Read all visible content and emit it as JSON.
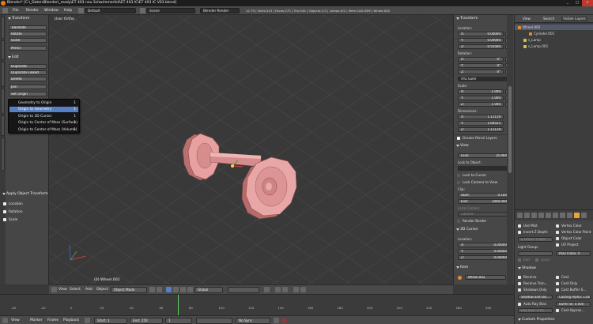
{
  "window": {
    "title": "Blender* [C:\\_Daten\\Blender\\_ready\\ET 403 neu Schwimmerfeil\\ET 403 IC\\ET 403 IC V03.blend]",
    "controls": [
      "_",
      "□",
      "×"
    ]
  },
  "info_header": {
    "menus": [
      "File",
      "Render",
      "Window",
      "Help"
    ],
    "screen_layout": "Default",
    "scene": "Scene",
    "engine": "Blender Render",
    "stats": "v2.79 | Verts:523 | Faces:275 | Tris:544 | Objects:1/3 | Lamps:0/2 | Mem:100.83M | Wheel.002"
  },
  "left_tools": {
    "tabs": [
      "Tools",
      "Create",
      "Relations",
      "Animation",
      "Physics",
      "Grease Pencil"
    ],
    "transform_header": "Transform",
    "transform_buttons": [
      "Translate",
      "Rotate",
      "Scale"
    ],
    "mirror": "Mirror",
    "edit_header": "Edit",
    "edit_buttons": [
      "Duplicate",
      "Duplicate Linked",
      "Delete",
      "Join"
    ],
    "set_origin": "Set Origin",
    "operator_header": "Apply Object Transform",
    "operator_checks": [
      {
        "label": "Location",
        "checked": true
      },
      {
        "label": "Rotation",
        "checked": true
      },
      {
        "label": "Scale",
        "checked": true
      }
    ]
  },
  "popup_menu": {
    "items": [
      {
        "label": "Geometry to Origin",
        "shortcut": "1",
        "selected": false
      },
      {
        "label": "Origin to Geometry",
        "shortcut": "1",
        "selected": true
      },
      {
        "label": "Origin to 3D Cursor",
        "shortcut": "1",
        "selected": false
      },
      {
        "label": "Origin to Center of Mass (Surface)",
        "shortcut": "1",
        "selected": false
      },
      {
        "label": "Origin to Center of Mass (Volume)",
        "shortcut": "1",
        "selected": false
      }
    ]
  },
  "viewport": {
    "view_label": "User Ortho",
    "object_label": "(0) Wheel.002",
    "model_color": "#e79d9d",
    "grid_color": "#4a4a4a",
    "axis_x_color": "#c83c3c",
    "axis_y_color": "#3fa03f",
    "axis_z_color": "#3f5fd0"
  },
  "right_panel": {
    "transform_header": "Transform",
    "location_label": "Location:",
    "location": [
      {
        "k": "X:",
        "v": "0.00000"
      },
      {
        "k": "Y:",
        "v": "0.00000"
      },
      {
        "k": "Z:",
        "v": "0.55560"
      }
    ],
    "rotation_label": "Rotation:",
    "rotation": [
      {
        "k": "X:",
        "v": "0°"
      },
      {
        "k": "Y:",
        "v": "0°"
      },
      {
        "k": "Z:",
        "v": "0°"
      }
    ],
    "rotation_mode": "XYZ Euler",
    "scale_label": "Scale:",
    "scale": [
      {
        "k": "X:",
        "v": "1.000"
      },
      {
        "k": "Y:",
        "v": "1.000"
      },
      {
        "k": "Z:",
        "v": "1.000"
      }
    ],
    "dimensions_label": "Dimensions:",
    "dimensions": [
      {
        "k": "X:",
        "v": "1.11119"
      },
      {
        "k": "Y:",
        "v": "1.64555"
      },
      {
        "k": "Z:",
        "v": "1.11119"
      }
    ],
    "grease_pencil": "Grease Pencil Layers",
    "view_header": "View",
    "lens": "Lens:",
    "lens_value": "35.000",
    "lock_to_object": "Lock to Object:",
    "lock_to_cursor": "Lock to Cursor",
    "lock_camera": "Lock Camera to View",
    "clip_label": "Clip:",
    "clip_start_k": "Start:",
    "clip_start": "0.100",
    "clip_end_k": "End:",
    "clip_end": "1000.000",
    "local_camera": "Local Camera:",
    "camera": "Camera",
    "render_border": "Render Border",
    "cursor_header": "3D Cursor",
    "cursor_location_label": "Location:",
    "cursor_location": [
      {
        "k": "X:",
        "v": "0.00000"
      },
      {
        "k": "Y:",
        "v": "0.00000"
      },
      {
        "k": "Z:",
        "v": "0.00000"
      }
    ],
    "item_header": "Item",
    "item_name": "Wheel.002"
  },
  "outliner": {
    "tabs": [
      "View",
      "Search",
      "Visible Layers"
    ],
    "rows": [
      {
        "label": "Wheel.002",
        "indent": 2,
        "color": "#e68a35"
      },
      {
        "label": "Cylinder.001",
        "indent": 16,
        "color": "#e68a35"
      },
      {
        "label": "s_Lamp",
        "indent": 9,
        "color": "#d6c04a"
      },
      {
        "label": "s_Lamp.001",
        "indent": 9,
        "color": "#d6c04a"
      }
    ]
  },
  "properties": {
    "use_mist": "Use Mist",
    "invert_z": "Invert Z Depth",
    "z_offset": "Z Offset: 0.000",
    "vertex_color": "Vertex Color",
    "vertex_color_paint": "Vertex Color Paint",
    "object_color": "Object Color",
    "uv_project": "UV Project",
    "light_group": "Light Group:",
    "pass_index": "Pass Index: 0",
    "exclusive": "Excl",
    "local": "Local",
    "shadow_header": "Shadow",
    "receive": "Receive",
    "receive_transparent": "Receive Tran...",
    "shadows_only": "Shadows Only",
    "shadow_shadow": "Shadow and Dis...",
    "cast": "Cast",
    "cast_only": "Cast Only",
    "cast_buffer": "Cast Buffer S...",
    "casting_alpha": "Casting Alpha: 1.000",
    "auto_ray_bias": "Auto Ray Bias",
    "buffer_bias": "Buffer Bi: 0.000",
    "ray_bias": "Ray Bias: 0.00",
    "cast_approx": "Cast Approx...",
    "custom_props": "Custom Properties"
  },
  "view_header": {
    "menus": [
      "View",
      "Select",
      "Add",
      "Object"
    ],
    "mode": "Object Mode",
    "pivot": "Global",
    "layers": "20"
  },
  "timeline": {
    "menus": [
      "View",
      "Marker",
      "Frame",
      "Playback"
    ],
    "start": "Start:",
    "start_value": "1",
    "end": "End:",
    "end_value": "250",
    "current": "1",
    "sync": "No Sync",
    "ticks": [
      "-40",
      "-20",
      "0",
      "20",
      "40",
      "60",
      "80",
      "100",
      "120",
      "140",
      "160",
      "180",
      "200",
      "220",
      "240",
      "260",
      "280"
    ]
  }
}
